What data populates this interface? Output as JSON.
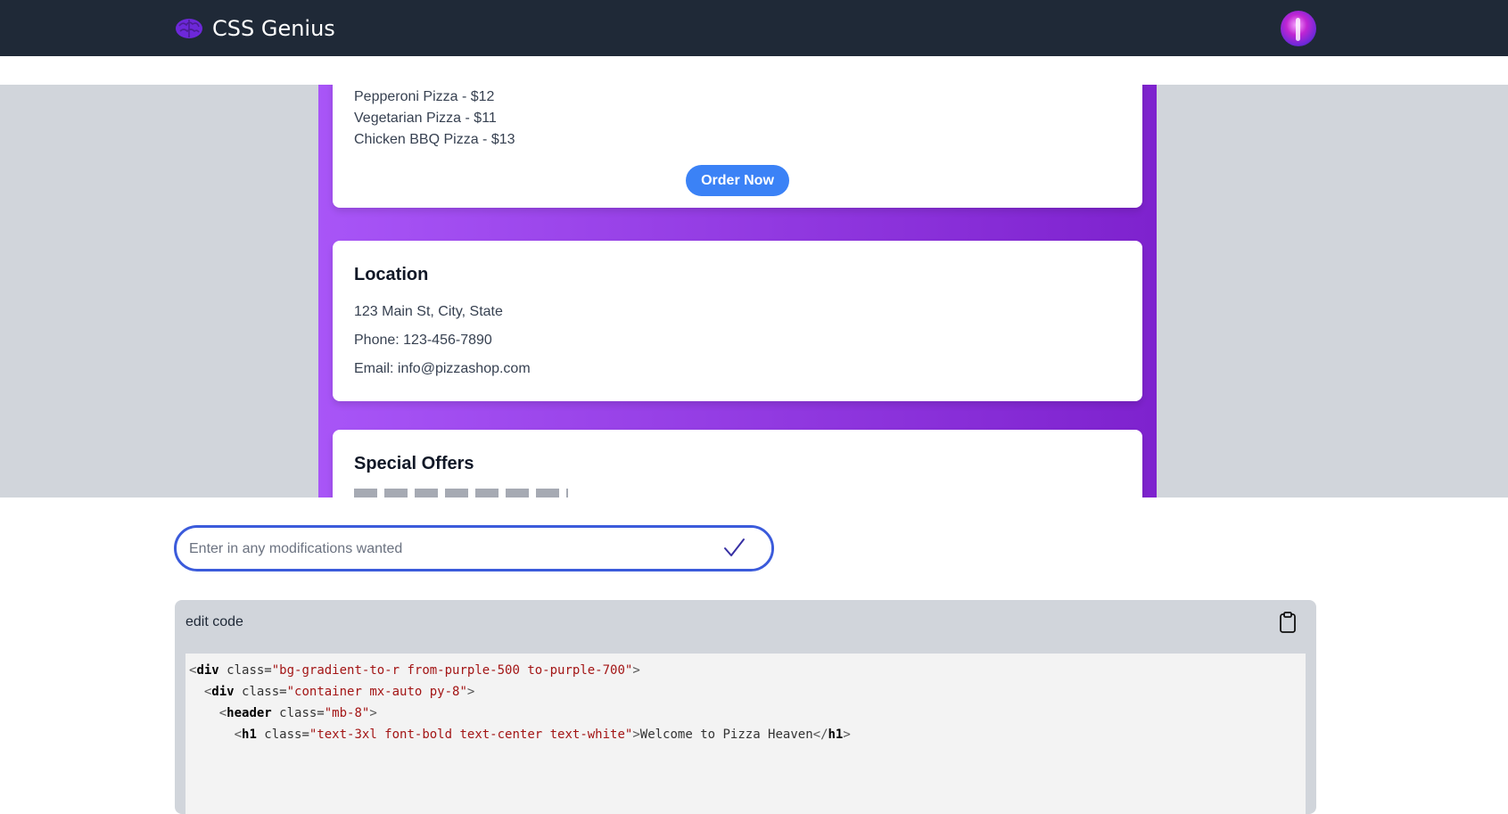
{
  "header": {
    "brand_icon": "brain-icon",
    "app_title": "CSS Genius",
    "avatar": "user-avatar"
  },
  "preview": {
    "menu_items": [
      "Pepperoni Pizza - $12",
      "Vegetarian Pizza - $11",
      "Chicken BBQ Pizza - $13"
    ],
    "order_button": "Order Now",
    "location": {
      "heading": "Location",
      "address": "123 Main St, City, State",
      "phone": "Phone: 123-456-7890",
      "email": "Email: info@pizzashop.com"
    },
    "offers": {
      "heading": "Special Offers"
    }
  },
  "modifications": {
    "placeholder": "Enter in any modifications wanted",
    "value": "",
    "submit_icon": "checkmark-icon"
  },
  "code_panel": {
    "title": "edit code",
    "copy_icon": "clipboard-icon",
    "lines": [
      {
        "indent": "",
        "tag": "div",
        "class": "bg-gradient-to-r from-purple-500 to-purple-700",
        "text": "",
        "close": false
      },
      {
        "indent": "  ",
        "tag": "div",
        "class": "container mx-auto py-8",
        "text": "",
        "close": false
      },
      {
        "indent": "    ",
        "tag": "header",
        "class": "mb-8",
        "text": "",
        "close": false
      },
      {
        "indent": "      ",
        "tag": "h1",
        "class": "text-3xl font-bold text-center text-white",
        "text": "Welcome to Pizza Heaven",
        "close": true
      }
    ]
  },
  "colors": {
    "navbar": "#1f2937",
    "accent_blue": "#3b82f6",
    "gradient_from": "#a855f7",
    "gradient_to": "#7e22ce",
    "input_border": "#3b5bdb"
  }
}
